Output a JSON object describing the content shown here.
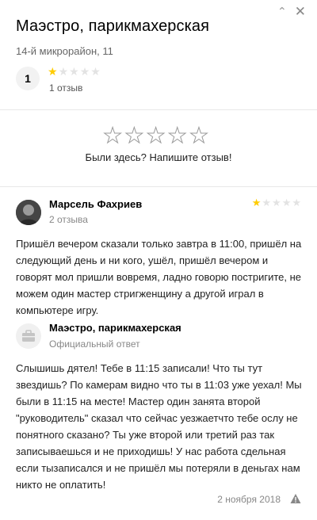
{
  "header": {
    "title": "Маэстро, парикмахерская",
    "address": "14-й микрорайон, 11",
    "rating_value": "1",
    "reviews_count": "1 отзыв",
    "rating_stars": 1,
    "max_stars": 5
  },
  "rate_prompt": {
    "text": "Были здесь? Напишите отзыв!"
  },
  "review": {
    "author": "Марсель Фахриев",
    "author_reviews": "2 отзыва",
    "stars": 1,
    "text": "Пришёл вечером сказали только завтра в 11:00, пришёл на следующий день и ни кого, ушёл, пришёл вечером и говорят мол пришли вовремя, ладно говорю постригите, не можем один мастер стригженщину а другой играл в компьютере игру.",
    "date": "2 ноября 2018"
  },
  "owner_reply": {
    "name": "Маэстро, парикмахерская",
    "subtitle": "Официальный ответ",
    "text": "Слышишь дятел! Тебе в 11:15 записали! Что ты тут звездишь? По камерам видно что ты в 11:03 уже уехал! Мы были в 11:15 на месте! Мастер один занята второй \"руководитель\" сказал что сейчас уезжаетчто тебе ослу не понятного сказано? Ты уже второй или третий раз так записываешься и не приходишь! У нас работа сдельная если тызаписался и не пришёл мы потеряли в деньгах нам никто не оплатить!"
  },
  "icons": {
    "top_left": "chevron-up-icon",
    "close": "close-icon",
    "star": "star-icon",
    "org_avatar": "briefcase-icon",
    "report": "warning-triangle-icon"
  },
  "colors": {
    "star_active": "#ffcc00",
    "star_inactive": "#e3e3e3",
    "muted_text": "#888888"
  }
}
